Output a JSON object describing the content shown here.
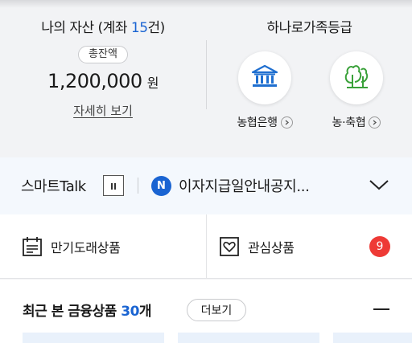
{
  "assets": {
    "title": "나의 자산 (계좌 ",
    "count": "15",
    "title_suffix": "건)",
    "total_label": "총잔액",
    "amount": "1,200,000",
    "currency": "원",
    "detail_link": "자세히 보기"
  },
  "family": {
    "title": "하나로가족등급",
    "banks": [
      {
        "label": "농협은행",
        "icon": "bank-building-icon"
      },
      {
        "label": "농·축협",
        "icon": "trees-icon"
      }
    ]
  },
  "talk": {
    "label": "스마트Talk",
    "badge": "N",
    "text": "이자지급일안내공지..."
  },
  "quick": {
    "maturity": "만기도래상품",
    "favorites": "관심상품",
    "favorites_count": "9"
  },
  "recent": {
    "title": "최근 본 금융상품 ",
    "count": "30",
    "title_suffix": "개",
    "more_button": "더보기"
  },
  "colors": {
    "accent": "#1a64d2",
    "notification": "#ee3a36",
    "icon_blue": "#1f6fd0",
    "icon_green": "#3aa13a"
  }
}
